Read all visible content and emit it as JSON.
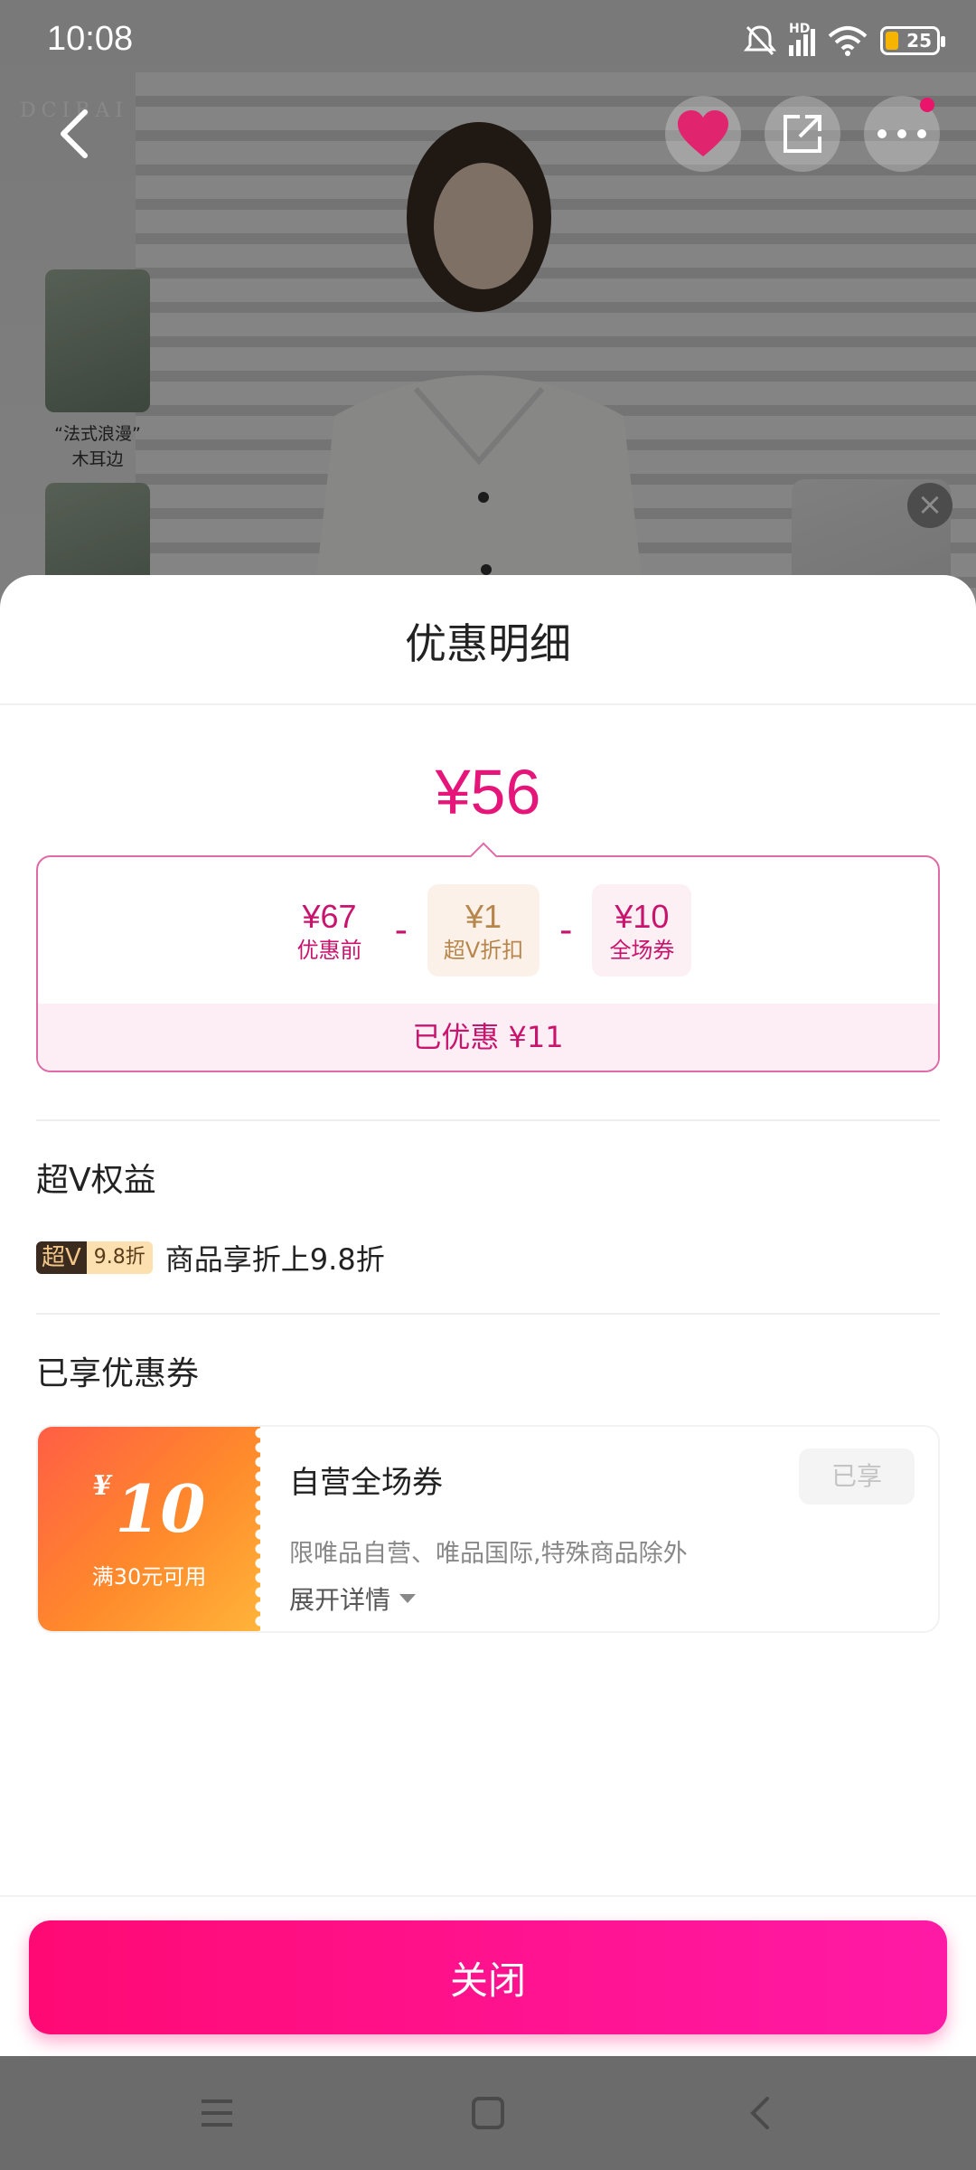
{
  "status_bar": {
    "time": "10:08",
    "signal_label": "HD",
    "battery": "25"
  },
  "background": {
    "logo_text": "DCIBAI",
    "thumb_caption_line1": "“法式浪漫”",
    "thumb_caption_line2": "木耳边"
  },
  "sheet": {
    "title": "优惠明细",
    "final_price": "¥56",
    "breakdown": {
      "original_amount": "¥67",
      "original_label": "优惠前",
      "minus": "-",
      "supervip_amount": "¥1",
      "supervip_label": "超V折扣",
      "coupon_amount": "¥10",
      "coupon_label": "全场券",
      "saved_text": "已优惠 ¥11"
    },
    "supervip_section": {
      "title": "超V权益",
      "badge_left": "超V",
      "badge_right": "9.8折",
      "text": "商品享折上9.8折"
    },
    "coupon_section": {
      "title": "已享优惠券",
      "coupon": {
        "currency": "¥",
        "amount": "10",
        "condition": "满30元可用",
        "name": "自营全场券",
        "status": "已享",
        "description": "限唯品自营、唯品国际,特殊商品除外",
        "expand_label": "展开详情"
      }
    },
    "close_label": "关闭"
  },
  "colors": {
    "accent": "#e5157a",
    "button_gradient_start": "#ff0a74",
    "button_gradient_end": "#ff1aa6",
    "coupon_gradient_start": "#ff5e45",
    "coupon_gradient_end": "#ffb43a"
  },
  "icons": {
    "back": "chevron-left-icon",
    "favorite": "heart-icon",
    "share": "share-icon",
    "more": "more-icon",
    "mute": "bell-off-icon",
    "signal": "signal-icon",
    "wifi": "wifi-icon",
    "battery": "battery-icon",
    "float_close": "close-icon",
    "expand": "caret-down-icon",
    "nav_menu": "menu-icon",
    "nav_home": "home-icon",
    "nav_back": "back-icon"
  }
}
